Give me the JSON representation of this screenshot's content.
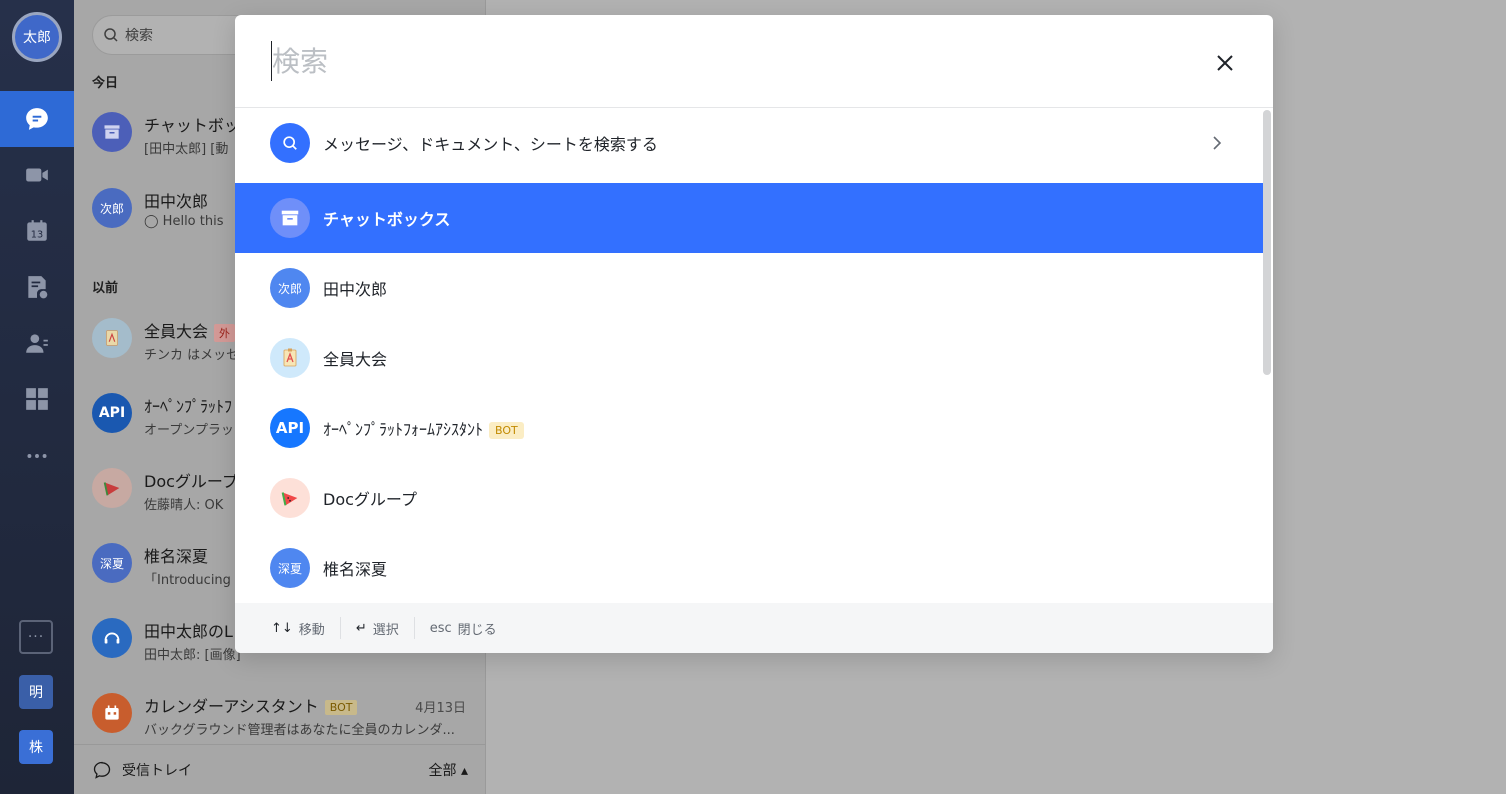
{
  "rail": {
    "avatar": "太郎",
    "bottom_1": "明",
    "bottom_2": "株"
  },
  "chatlist": {
    "search_placeholder": "検索",
    "section_today": "今日",
    "section_earlier": "以前",
    "chats": [
      {
        "name": "チャットボックス",
        "preview": "[田中太郎] [動",
        "avatar": ""
      },
      {
        "name": "田中次郎",
        "preview": "◯ Hello this",
        "avatar": "次郎"
      },
      {
        "name": "全員大会",
        "tag": "外",
        "preview": "チンカ はメッセー",
        "avatar": ""
      },
      {
        "name": "ｵｰﾍﾟﾝﾌﾟﾗｯﾄﾌ",
        "preview": "オープンプラット",
        "avatar": "API"
      },
      {
        "name": "Docグループ",
        "preview": "佐藤晴人: OK",
        "avatar": ""
      },
      {
        "name": "椎名深夏",
        "preview": "「Introducing",
        "avatar": "深夏"
      },
      {
        "name": "田中太郎のL",
        "preview": "田中太郎: [画像]",
        "avatar": ""
      },
      {
        "name": "カレンダーアシスタント",
        "tag": "BOT",
        "date": "4月13日",
        "preview": "バックグラウンド管理者はあなたに全員のカレンダ...",
        "avatar": ""
      }
    ],
    "footer_label": "受信トレイ",
    "footer_filter": "全部 ▴"
  },
  "modal": {
    "search_placeholder": "検索",
    "search_value": "",
    "results": [
      {
        "label": "メッセージ、ドキュメント、シートを検索する",
        "icon": "search-icon",
        "color": "#3370ff"
      },
      {
        "label": "チャットボックス",
        "icon": "archive-box-icon",
        "color": "#6f8ff9",
        "selected": true
      },
      {
        "label": "田中次郎",
        "avatar_text": "次郎",
        "color": "#4f87f0"
      },
      {
        "label": "全員大会",
        "icon": "assembly-icon",
        "color": "#cfe9fb"
      },
      {
        "label": "ｵｰﾍﾟﾝﾌﾟﾗｯﾄﾌｫｰﾑｱｼｽﾀﾝﾄ",
        "badge": "BOT",
        "avatar_text": "API",
        "color": "#1677ff"
      },
      {
        "label": "Docグループ",
        "icon": "watermelon-icon",
        "color": "#fde0d8"
      },
      {
        "label": "椎名深夏",
        "avatar_text": "深夏",
        "color": "#4f87f0"
      }
    ],
    "footer": {
      "move_key": "↑↓",
      "move_label": "移動",
      "select_key": "↵",
      "select_label": "選択",
      "esc_key": "esc",
      "esc_label": "閉じる"
    }
  },
  "colors": {
    "accent": "#3370ff",
    "rail_bg": "#222a40",
    "bot_badge_bg": "#fbedc4",
    "bot_badge_fg": "#c28a00"
  }
}
